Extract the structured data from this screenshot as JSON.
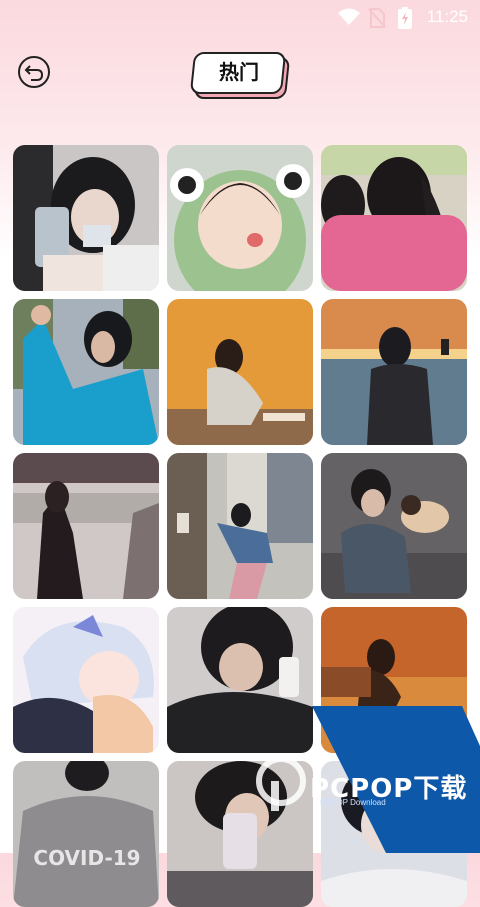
{
  "status_bar": {
    "time": "11:25",
    "icons": [
      "wifi-icon",
      "no-sim-icon",
      "battery-charging-icon"
    ]
  },
  "header": {
    "back_icon": "back-arrow-icon",
    "title": "热门"
  },
  "colors": {
    "background_top": "#fbd9de",
    "title_shadow": "#f2a7b5",
    "watermark_blue": "#0d58a8"
  },
  "gallery": {
    "photos": [
      {
        "label": "girl with phone selfie"
      },
      {
        "label": "child in frog hood"
      },
      {
        "label": "girl in pink hoodie"
      },
      {
        "label": "person in teal jacket"
      },
      {
        "label": "girl crouching by wall"
      },
      {
        "label": "girl at sunset sea"
      },
      {
        "label": "blurred girl walking"
      },
      {
        "label": "boy on street"
      },
      {
        "label": "girl hugging dog"
      },
      {
        "label": "anime silver hair boy"
      },
      {
        "label": "boy with phone"
      },
      {
        "label": "girl sunset water"
      },
      {
        "label": "boy gray hoodie"
      },
      {
        "label": "boy with phone selfie"
      },
      {
        "label": "boy portrait"
      }
    ],
    "hoodie_text": "COVID-19"
  },
  "watermark": {
    "text": "PCPOP下载",
    "subtext": "PCPOP Download"
  }
}
